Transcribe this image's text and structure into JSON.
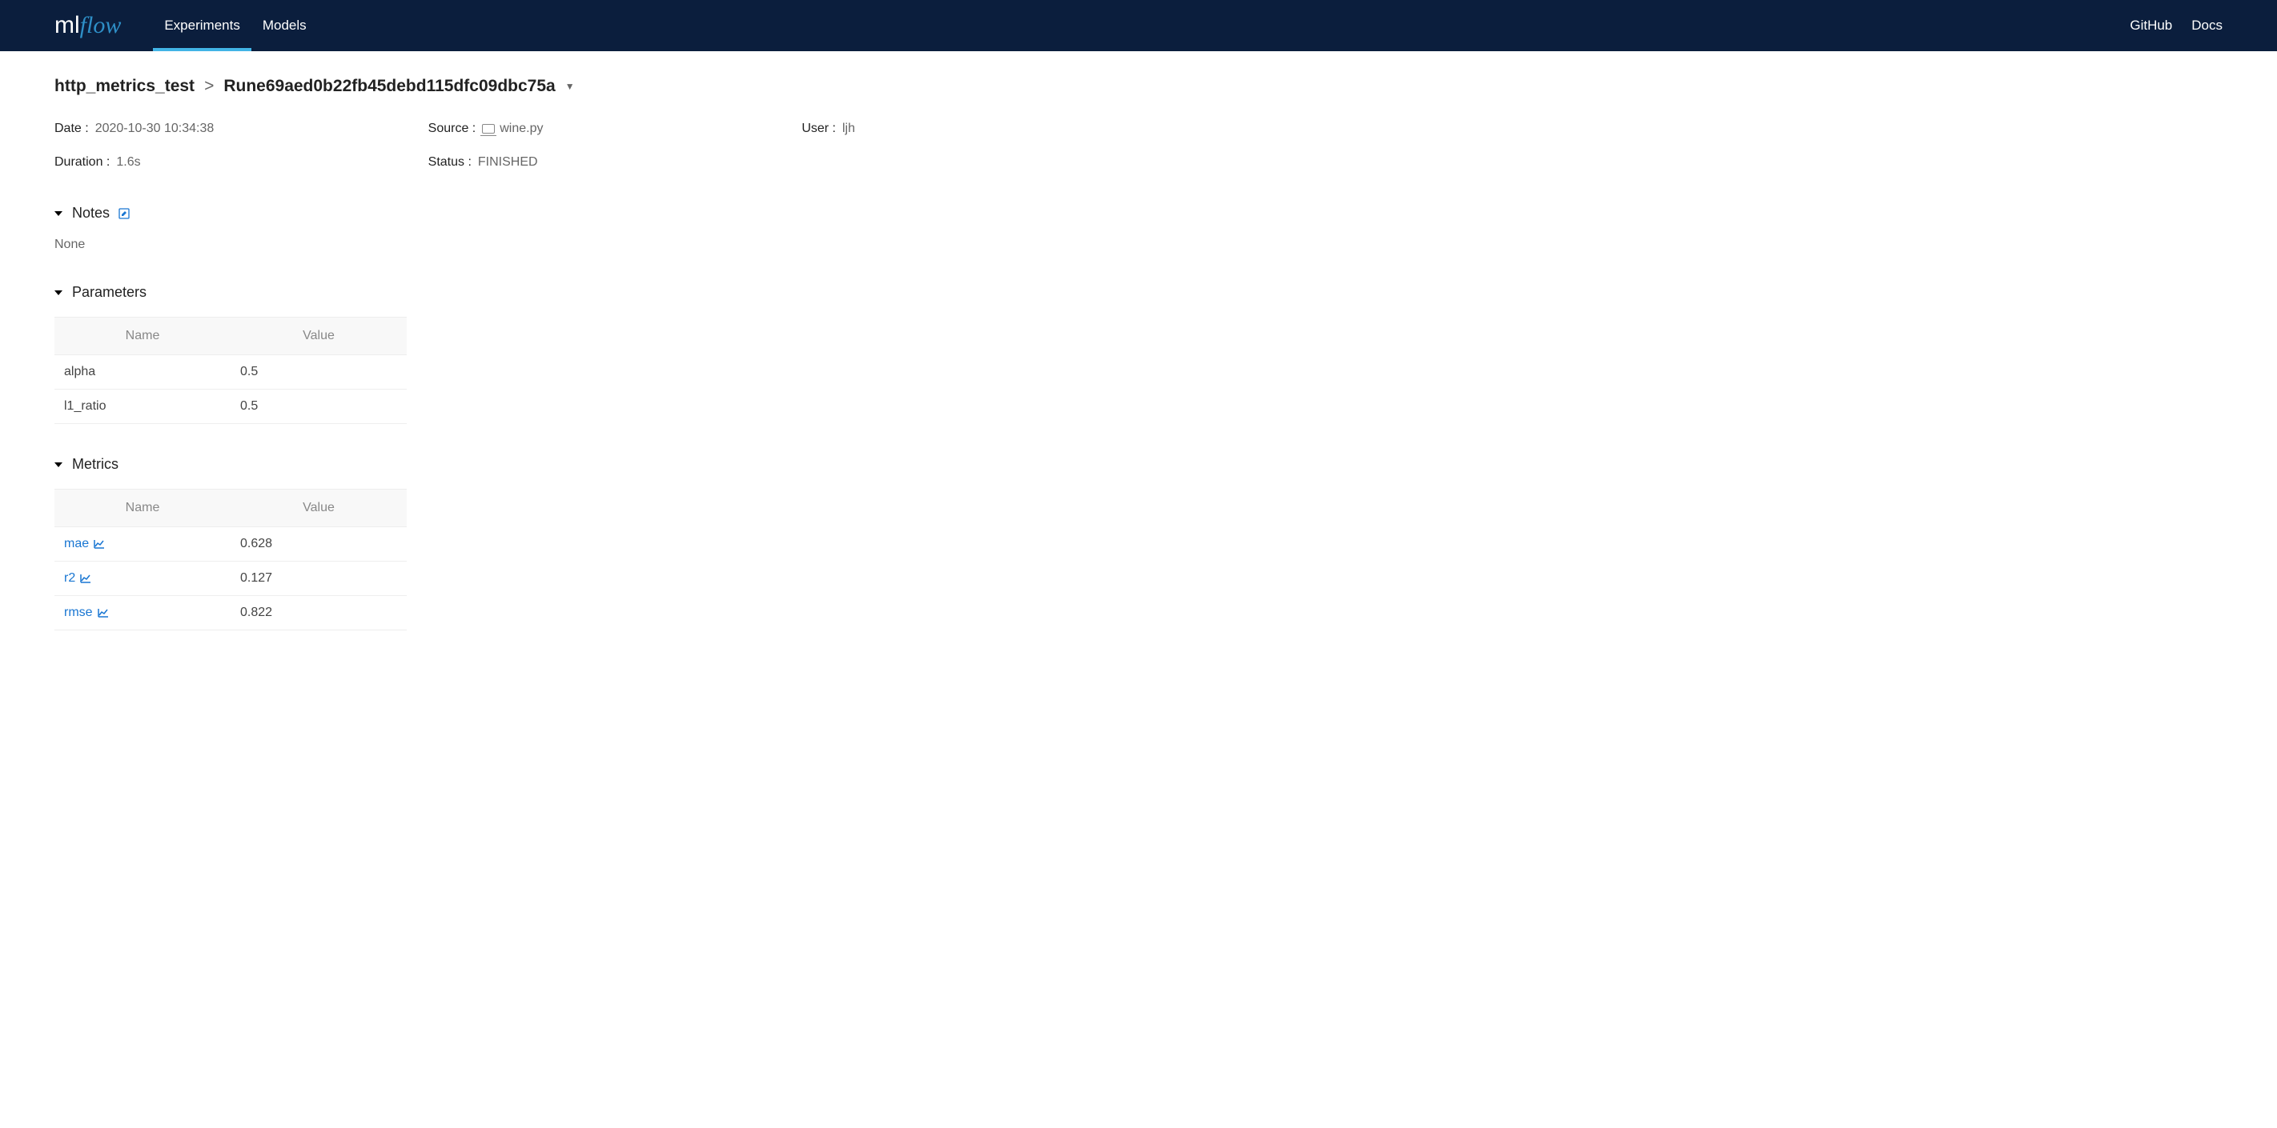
{
  "nav": {
    "logo_ml": "ml",
    "logo_flow": "flow",
    "experiments": "Experiments",
    "models": "Models",
    "github": "GitHub",
    "docs": "Docs"
  },
  "breadcrumb": {
    "experiment": "http_metrics_test",
    "run_prefix": "Run ",
    "run_id": "e69aed0b22fb45debd115dfc09dbc75a"
  },
  "meta": {
    "date_label": "Date :",
    "date_value": "2020-10-30 10:34:38",
    "source_label": "Source :",
    "source_value": "wine.py",
    "user_label": "User :",
    "user_value": "ljh",
    "duration_label": "Duration :",
    "duration_value": "1.6s",
    "status_label": "Status :",
    "status_value": "FINISHED"
  },
  "sections": {
    "notes_title": "Notes",
    "notes_content": "None",
    "parameters_title": "Parameters",
    "metrics_title": "Metrics"
  },
  "table_headers": {
    "name": "Name",
    "value": "Value"
  },
  "parameters": [
    {
      "name": "alpha",
      "value": "0.5"
    },
    {
      "name": "l1_ratio",
      "value": "0.5"
    }
  ],
  "metrics": [
    {
      "name": "mae",
      "value": "0.628"
    },
    {
      "name": "r2",
      "value": "0.127"
    },
    {
      "name": "rmse",
      "value": "0.822"
    }
  ]
}
